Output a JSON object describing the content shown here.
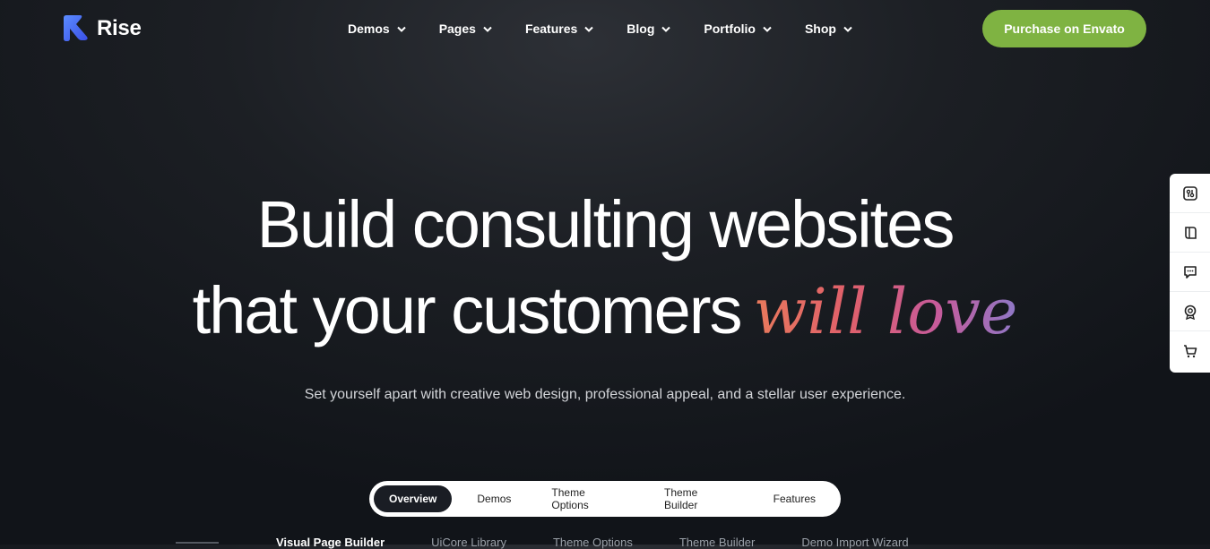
{
  "header": {
    "logo_text": "Rise",
    "nav": [
      {
        "label": "Demos"
      },
      {
        "label": "Pages"
      },
      {
        "label": "Features"
      },
      {
        "label": "Blog"
      },
      {
        "label": "Portfolio"
      },
      {
        "label": "Shop"
      }
    ],
    "purchase_label": "Purchase on Envato"
  },
  "hero": {
    "line1": "Build consulting websites",
    "line2_plain": "that your customers",
    "line2_script": "will love",
    "subtitle": "Set yourself apart with creative web design, professional appeal, and a stellar user experience."
  },
  "tabs": [
    {
      "label": "Overview",
      "active": true
    },
    {
      "label": "Demos"
    },
    {
      "label": "Theme Options"
    },
    {
      "label": "Theme Builder"
    },
    {
      "label": "Features"
    }
  ],
  "subtabs": [
    {
      "label": "Visual Page Builder",
      "active": true
    },
    {
      "label": "UiCore Library"
    },
    {
      "label": "Theme Options"
    },
    {
      "label": "Theme Builder"
    },
    {
      "label": "Demo Import Wizard"
    }
  ],
  "side_icons": [
    "settings-sliders-icon",
    "book-icon",
    "chat-icon",
    "award-icon",
    "cart-icon"
  ],
  "colors": {
    "accent_green": "#7fb342",
    "script_gradient_start": "#e87a5c",
    "script_gradient_end": "#8f78c7",
    "logo_blue": "#4f6bff"
  }
}
